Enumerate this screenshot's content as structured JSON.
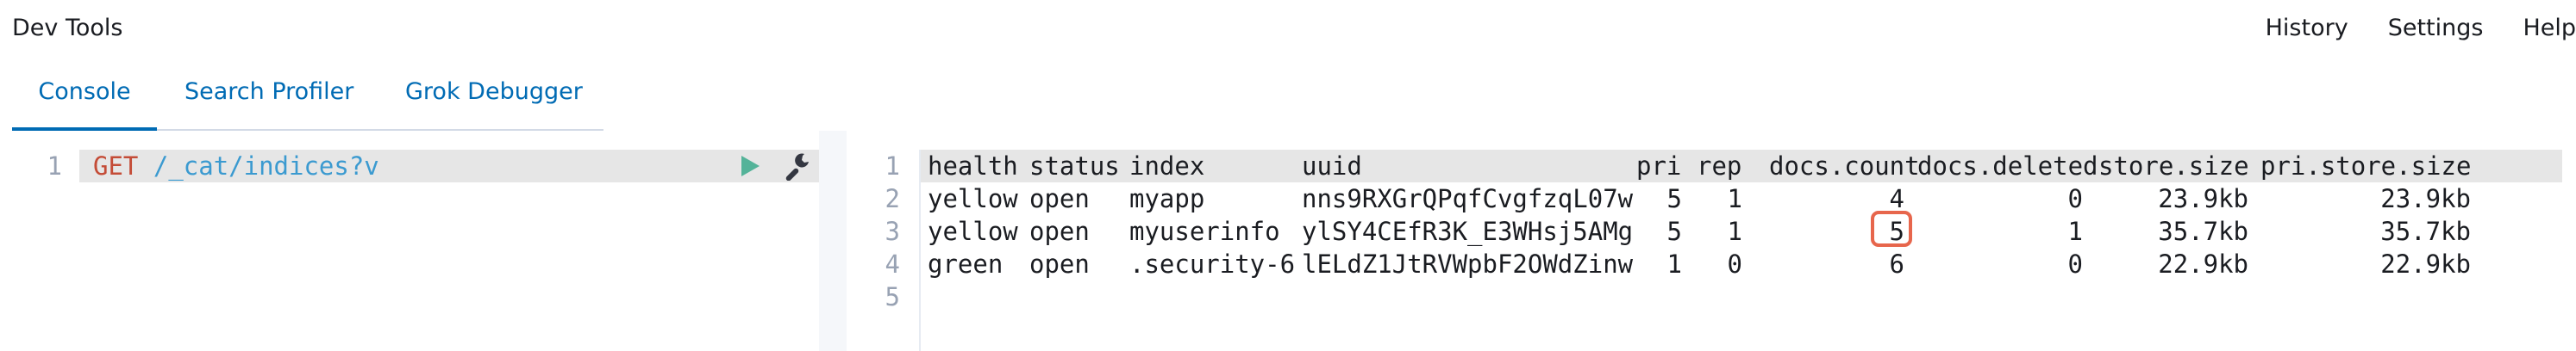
{
  "app": {
    "title": "Dev Tools"
  },
  "top_nav": {
    "history": "History",
    "settings": "Settings",
    "help": "Help"
  },
  "tabs": [
    {
      "label": "Console",
      "active": true
    },
    {
      "label": "Search Profiler",
      "active": false
    },
    {
      "label": "Grok Debugger",
      "active": false
    }
  ],
  "request_editor": {
    "line_numbers": [
      "1"
    ],
    "method": "GET",
    "path": "/_cat/indices?v",
    "icons": {
      "run": "play-icon",
      "settings": "wrench-icon"
    }
  },
  "response_output": {
    "line_numbers": [
      "1",
      "2",
      "3",
      "4",
      "5"
    ],
    "headers": [
      "health",
      "status",
      "index",
      "uuid",
      "pri",
      "rep",
      "docs.count",
      "docs.deleted",
      "store.size",
      "pri.store.size"
    ],
    "rows": [
      [
        "yellow",
        "open",
        "myapp",
        "nns9RXGrQPqfCvgfzqL07w",
        "5",
        "1",
        "4",
        "0",
        "23.9kb",
        "23.9kb"
      ],
      [
        "yellow",
        "open",
        "myuserinfo",
        "ylSY4CEfR3K_E3WHsj5AMg",
        "5",
        "1",
        "5",
        "1",
        "35.7kb",
        "35.7kb"
      ],
      [
        "green",
        "open",
        ".security-6",
        "lELdZ1JtRVWpbF2OWdZinw",
        "1",
        "0",
        "6",
        "0",
        "22.9kb",
        "22.9kb"
      ]
    ],
    "highlighted_cell": {
      "row": 1,
      "column": "docs.count",
      "color": "#e7664c"
    }
  },
  "colors": {
    "accent": "#006bb4",
    "method": "#c44c37",
    "path": "#3b9ad0",
    "run_button": "#54b399",
    "highlight": "#e7664c"
  }
}
